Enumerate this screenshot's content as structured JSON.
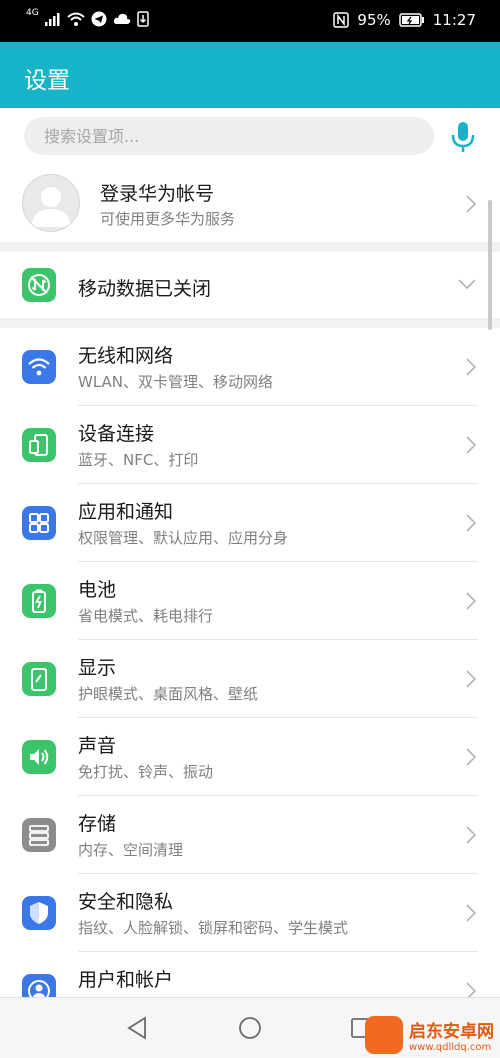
{
  "status_bar": {
    "network": "4G",
    "battery": "95%",
    "time": "11:27"
  },
  "header": {
    "title": "设置"
  },
  "search": {
    "placeholder": "搜索设置项..."
  },
  "account": {
    "title": "登录华为帐号",
    "subtitle": "可使用更多华为服务"
  },
  "mobile_data": {
    "label": "移动数据已关闭"
  },
  "menu": [
    {
      "title": "无线和网络",
      "subtitle": "WLAN、双卡管理、移动网络",
      "icon": "wifi-icon",
      "color": "#3b78e7"
    },
    {
      "title": "设备连接",
      "subtitle": "蓝牙、NFC、打印",
      "icon": "device-connect-icon",
      "color": "#3cc46a"
    },
    {
      "title": "应用和通知",
      "subtitle": "权限管理、默认应用、应用分身",
      "icon": "apps-icon",
      "color": "#3b78e7"
    },
    {
      "title": "电池",
      "subtitle": "省电模式、耗电排行",
      "icon": "battery-icon",
      "color": "#3cc46a"
    },
    {
      "title": "显示",
      "subtitle": "护眼模式、桌面风格、壁纸",
      "icon": "display-icon",
      "color": "#3cc46a"
    },
    {
      "title": "声音",
      "subtitle": "免打扰、铃声、振动",
      "icon": "sound-icon",
      "color": "#3cc46a"
    },
    {
      "title": "存储",
      "subtitle": "内存、空间清理",
      "icon": "storage-icon",
      "color": "#8c8c8c"
    },
    {
      "title": "安全和隐私",
      "subtitle": "指纹、人脸解锁、锁屏和密码、学生模式",
      "icon": "shield-icon",
      "color": "#3b78e7"
    },
    {
      "title": "用户和帐户",
      "subtitle": "",
      "icon": "user-icon",
      "color": "#3b78e7"
    }
  ],
  "watermark": {
    "name": "启东安卓网",
    "url": "www.qdlldq.com"
  },
  "colors": {
    "header": "#17b4c9",
    "accent_blue": "#3b78e7",
    "accent_green": "#3cc46a"
  }
}
